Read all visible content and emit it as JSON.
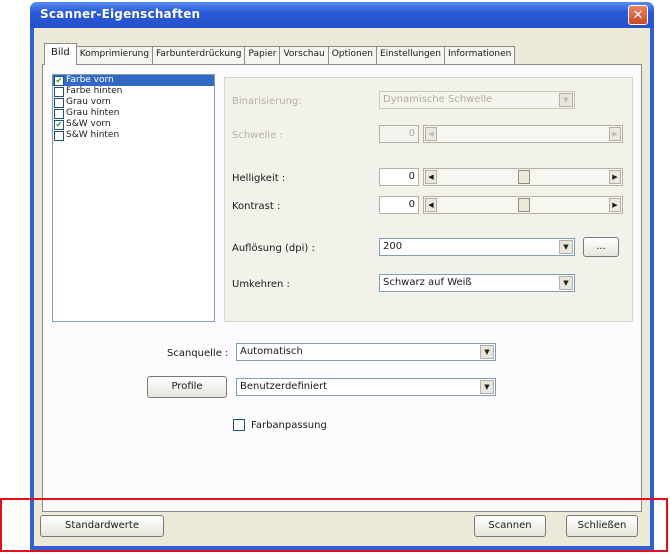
{
  "window": {
    "title": "Scanner-Eigenschaften",
    "close_glyph": "✕"
  },
  "tabs": [
    {
      "label": "Bild",
      "active": true
    },
    {
      "label": "Komprimierung"
    },
    {
      "label": "Farbunterdrückung"
    },
    {
      "label": "Papier"
    },
    {
      "label": "Vorschau"
    },
    {
      "label": "Optionen"
    },
    {
      "label": "Einstellungen"
    },
    {
      "label": "Informationen"
    }
  ],
  "image_list": [
    {
      "label": "Farbe vorn",
      "checked": true,
      "selected": true
    },
    {
      "label": "Farbe hinten",
      "checked": false
    },
    {
      "label": "Grau vorn",
      "checked": false
    },
    {
      "label": "Grau hinten",
      "checked": false
    },
    {
      "label": "S&W vorn",
      "checked": true
    },
    {
      "label": "S&W hinten",
      "checked": false
    }
  ],
  "settings": {
    "binarization": {
      "label": "Binarisierung:",
      "value": "Dynamische Schwelle"
    },
    "threshold": {
      "label": "Schwelle :",
      "value": "0"
    },
    "brightness": {
      "label": "Helligkeit :",
      "value": "0"
    },
    "contrast": {
      "label": "Kontrast :",
      "value": "0"
    },
    "resolution": {
      "label": "Auflösung (dpi) :",
      "value": "200",
      "more_label": "..."
    },
    "invert": {
      "label": "Umkehren :",
      "value": "Schwarz auf Weiß"
    }
  },
  "scan_source": {
    "label": "Scanquelle :",
    "value": "Automatisch"
  },
  "profile": {
    "button_label": "Profile",
    "value": "Benutzerdefiniert"
  },
  "color_matching": {
    "label": "Farbanpassung",
    "checked": false
  },
  "footer": {
    "defaults_label": "Standardwerte",
    "scan_label": "Scannen",
    "close_label": "Schließen"
  },
  "colors": {
    "highlight": "#e0101c",
    "titlebar": "#2352c9"
  }
}
